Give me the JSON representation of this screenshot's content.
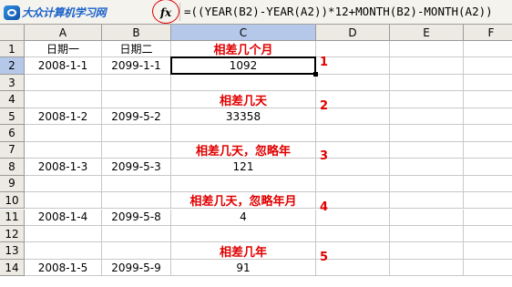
{
  "logo": {
    "text": "大众计算机学习网"
  },
  "formula_bar": {
    "fx_icon": "fx-icon",
    "formula": "=((YEAR(B2)-YEAR(A2))*12+MONTH(B2)-MONTH(A2))"
  },
  "columns": [
    "A",
    "B",
    "C",
    "D",
    "E",
    "F"
  ],
  "rows": [
    "1",
    "2",
    "3",
    "4",
    "5",
    "6",
    "7",
    "8",
    "9",
    "10",
    "11",
    "12",
    "13",
    "14"
  ],
  "cells": {
    "A1": "日期一",
    "B1": "日期二",
    "C1": "相差几个月",
    "A2": "2008-1-1",
    "B2": "2099-1-1",
    "C2": "1092",
    "C4": "相差几天",
    "A5": "2008-1-2",
    "B5": "2099-5-2",
    "C5": "33358",
    "C7": "相差几天，忽略年",
    "A8": "2008-1-3",
    "B8": "2099-5-3",
    "C8": "121",
    "C10": "相差几天，忽略年月",
    "A11": "2008-1-4",
    "B11": "2099-5-8",
    "C11": "4",
    "C13": "相差几年",
    "A14": "2008-1-5",
    "B14": "2099-5-9",
    "C14": "91"
  },
  "markers": [
    "1",
    "2",
    "3",
    "4",
    "5"
  ],
  "colors": {
    "annotation_red": "#e00000",
    "selection_header": "#b5c8ea"
  }
}
